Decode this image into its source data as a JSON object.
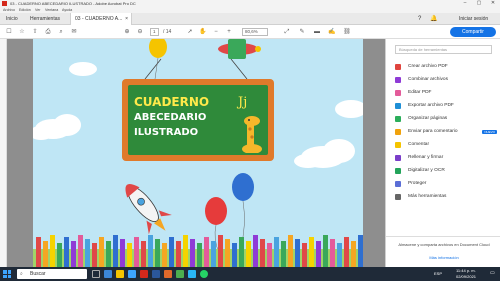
{
  "window": {
    "title": "03 - CUADERNO ABECEDARIO ILUSTRADO - Adobe Acrobat Pro DC",
    "menu": [
      "Archivo",
      "Edición",
      "Ver",
      "Ventana",
      "Ayuda"
    ]
  },
  "tabs": {
    "items": [
      "Inicio",
      "Herramientas",
      "03 - CUADERNO A..."
    ],
    "close": "×",
    "signin": "Iniciar sesión"
  },
  "toolbar": {
    "page_current": "1",
    "page_total": "/ 14",
    "zoom": "80,6%",
    "share_label": "Compartir"
  },
  "document": {
    "board_line1": "CUADERNO",
    "board_line2": "ABECEDARIO",
    "board_line3": "ILUSTRADO",
    "board_letters": "Jj",
    "colors": {
      "sky": "#bfe6f5",
      "board_frame": "#e07a2b",
      "board_green": "#2f8a3a"
    }
  },
  "panel": {
    "search_placeholder": "Búsqueda de herramientas",
    "tools": [
      {
        "label": "Crear archivo PDF",
        "color": "#e0443e"
      },
      {
        "label": "Combinar archivos",
        "color": "#8f3bd6"
      },
      {
        "label": "Editar PDF",
        "color": "#e35b9a"
      },
      {
        "label": "Exportar archivo PDF",
        "color": "#1f8fd6"
      },
      {
        "label": "Organizar páginas",
        "color": "#2cae5b"
      },
      {
        "label": "Enviar para comentario",
        "color": "#f0a20c",
        "badge": "NUEVO"
      },
      {
        "label": "Comentar",
        "color": "#f5c400"
      },
      {
        "label": "Rellenar y firmar",
        "color": "#7a3ec9"
      },
      {
        "label": "Digitalizar y OCR",
        "color": "#23a45a"
      },
      {
        "label": "Proteger",
        "color": "#5b6ed6"
      },
      {
        "label": "Más herramientas",
        "color": "#666666"
      }
    ],
    "footer_text": "Almacene y comparta archivos en Document Cloud",
    "footer_link": "Más información"
  },
  "taskbar": {
    "search": "Buscar",
    "time": "11:44 p. m.",
    "date": "02/09/2021",
    "lang": "ESP"
  }
}
